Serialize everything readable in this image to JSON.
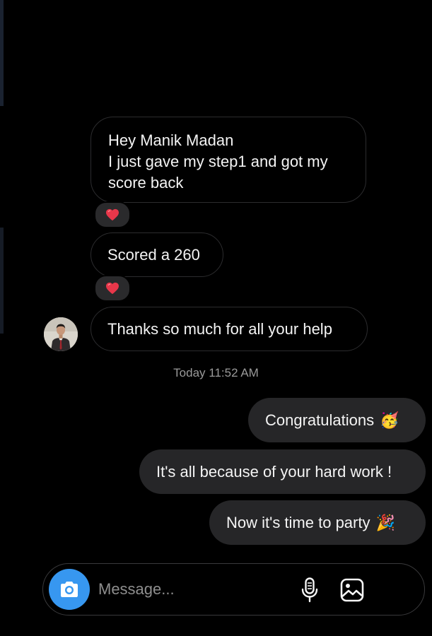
{
  "incoming": {
    "message_1": {
      "line_1": "Hey Manik Madan",
      "line_2": "I just gave my step1 and got my",
      "line_3": "score back"
    },
    "message_2": "Scored a 260",
    "message_3": "Thanks so much for all your help",
    "reaction_icon": "heart-emoji"
  },
  "timestamp": "Today 11:52 AM",
  "outgoing": [
    {
      "text": "Congratulations",
      "emoji": "🥳"
    },
    {
      "text": "It's all because of your hard work !"
    },
    {
      "text": "Now it's time to party",
      "emoji": "🎉"
    }
  ],
  "composer": {
    "placeholder": "Message...",
    "camera_icon": "camera-icon",
    "mic_icon": "microphone-icon",
    "gallery_icon": "image-gallery-icon"
  },
  "colors": {
    "background": "#000000",
    "incoming_border": "#2c2c2e",
    "outgoing_bubble": "#262628",
    "accent_blue": "#3797f0",
    "heart_red": "#e8374a"
  }
}
